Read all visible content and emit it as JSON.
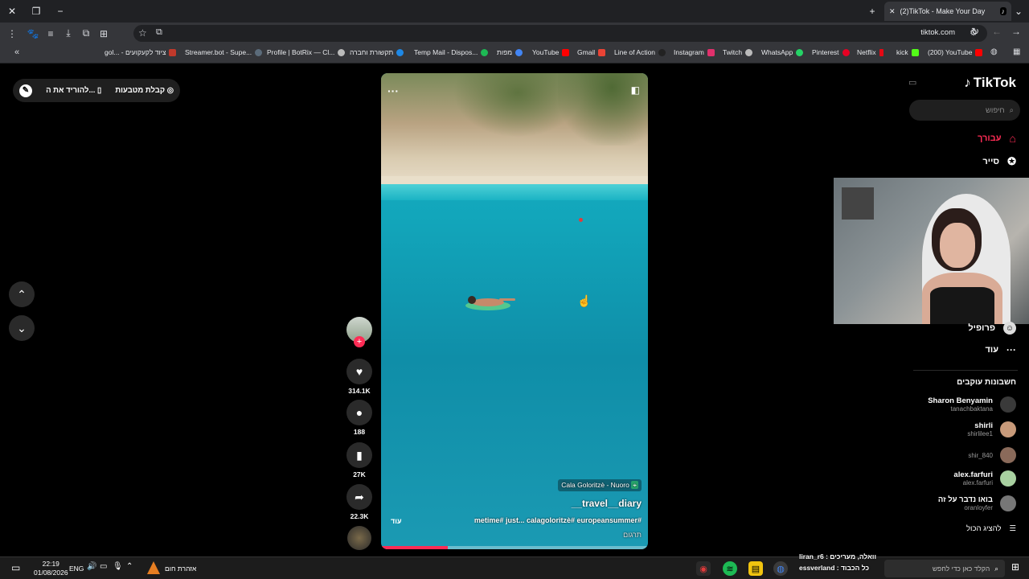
{
  "browser": {
    "tab_title": "(2)TikTok - Make Your Day",
    "url": "tiktok.com",
    "bookmarks": [
      {
        "label": "gol... - ציוד לקעקועים",
        "color": "#c0392b"
      },
      {
        "label": "Streamer.bot - Supe...",
        "color": "#5b6b7a"
      },
      {
        "label": "Profile | BotRix — Cl...",
        "color": "#7a7a7a"
      },
      {
        "label": "תקשורת וחברה",
        "color": "#1e88e5"
      },
      {
        "label": "Temp Mail - Dispos...",
        "color": "#1e88e5"
      },
      {
        "label": "מפות",
        "color": "#1db954"
      },
      {
        "label": "YouTube",
        "color": "#ff0000"
      },
      {
        "label": "Gmail",
        "color": "#ea4335"
      },
      {
        "label": "Line of Action",
        "color": "#333333"
      },
      {
        "label": "Instagram",
        "color": "#e1306c"
      },
      {
        "label": "Twitch",
        "color": "#7a7a7a"
      },
      {
        "label": "WhatsApp",
        "color": "#25d366"
      },
      {
        "label": "Pinterest",
        "color": "#e60023"
      },
      {
        "label": "Netflix",
        "color": "#e50914"
      },
      {
        "label": "kick",
        "color": "#53fc18"
      },
      {
        "label": "(200) YouTube",
        "color": "#ff0000"
      }
    ]
  },
  "left": {
    "get_coins": "קבלת מטבעות",
    "download": "להוריד את ה..."
  },
  "video": {
    "location": "Cala Goloritzè - Nuoro",
    "author": "__travel__diary",
    "caption": "metime# just... calagoloritzè# europeansummer#",
    "more": "עוד",
    "translate": "תרגום",
    "progress_fraction": 0.25
  },
  "actions": {
    "likes": "314.1K",
    "comments": "188",
    "saves": "27K",
    "shares": "22.3K"
  },
  "sidebar": {
    "logo": "TikTok",
    "search_placeholder": "חיפוש",
    "nav": [
      {
        "label": "עבורך",
        "icon": "home-icon"
      },
      {
        "label": "סייר",
        "icon": "compass-icon"
      },
      {
        "label": "פרופיל",
        "icon": "profile-icon"
      },
      {
        "label": "עוד",
        "icon": "more-icon"
      }
    ],
    "following_title": "חשבונות עוקבים",
    "accounts": [
      {
        "name": "Sharon Benyamin",
        "handle": "tanachbaktana"
      },
      {
        "name": "shirli",
        "handle": "shirlilee1"
      },
      {
        "name": "",
        "handle": "shir_840"
      },
      {
        "name": "alex.farfuri",
        "handle": "alex.farfuri"
      },
      {
        "name": "בואו נדבר על זה",
        "handle": "oranloyfer"
      }
    ],
    "show_all": "להציג הכול"
  },
  "chat_overlay": {
    "line1": "liran_r6 : וואלה, מעריכים",
    "line2": "essverland : כל הכבוד"
  },
  "taskbar": {
    "time": "22:19",
    "date": "01/08/2026",
    "lang": "ENG",
    "weather": "אזהרת חום",
    "search_placeholder": "הקלד כאן כדי לחפש"
  }
}
